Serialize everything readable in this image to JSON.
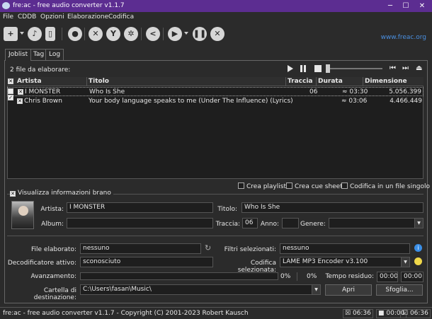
{
  "window": {
    "title": "fre:ac - free audio converter v1.1.7"
  },
  "menu": [
    "File",
    "CDDB",
    "Opzioni",
    "Elaborazione",
    "Codifica"
  ],
  "toolbar": {
    "url": "www.freac.org"
  },
  "tabs": [
    "Joblist",
    "Tag",
    "Log"
  ],
  "joblist": {
    "count_text": "2 file da elaborare:",
    "columns": [
      "Artista",
      "Titolo",
      "Traccia",
      "Durata",
      "Dimensione"
    ],
    "rows": [
      {
        "artist": "I MONSTER",
        "title": "Who Is She",
        "track": "06",
        "duration": "≈ 03:30",
        "size": "5.056.399"
      },
      {
        "artist": "Chris Brown",
        "title": "Your body language speaks to me (Under The Influence) (Lyrics)",
        "track": "",
        "duration": "≈ 03:06",
        "size": "4.466.449"
      }
    ]
  },
  "options": {
    "playlist": "Crea playlist",
    "cue": "Crea cue sheet",
    "single": "Codifica in un file singolo"
  },
  "info": {
    "toggle": "Visualizza informazioni brano",
    "artist_label": "Artista:",
    "artist": "I MONSTER",
    "title_label": "Titolo:",
    "title": "Who Is She",
    "album_label": "Album:",
    "album": "",
    "track_label": "Traccia:",
    "track": "06",
    "year_label": "Anno:",
    "year": "",
    "genre_label": "Genere:",
    "genre": ""
  },
  "status": {
    "file_label": "File elaborato:",
    "file": "nessuno",
    "filters_label": "Filtri selezionati:",
    "filters": "nessuno",
    "decoder_label": "Decodificatore attivo:",
    "decoder": "sconosciuto",
    "encoder_label": "Codifica selezionata:",
    "encoder": "LAME MP3 Encoder v3.100",
    "progress_label": "Avanzamento:",
    "progress1": "0%",
    "progress2": "0%",
    "remaining_label": "Tempo residuo:",
    "time1": "00:00",
    "time2": "00:00",
    "dest_label": "Cartella di destinazione:",
    "dest": "C:\\Users\\fasan\\Music\\",
    "open_btn": "Apri",
    "browse_btn": "Sfoglia..."
  },
  "statusbar": {
    "text": "fre:ac - free audio converter v1.1.7 - Copyright (C) 2001-2023 Robert Kausch",
    "t1": "06:36",
    "t2": "00:00",
    "t3": "06:36"
  }
}
